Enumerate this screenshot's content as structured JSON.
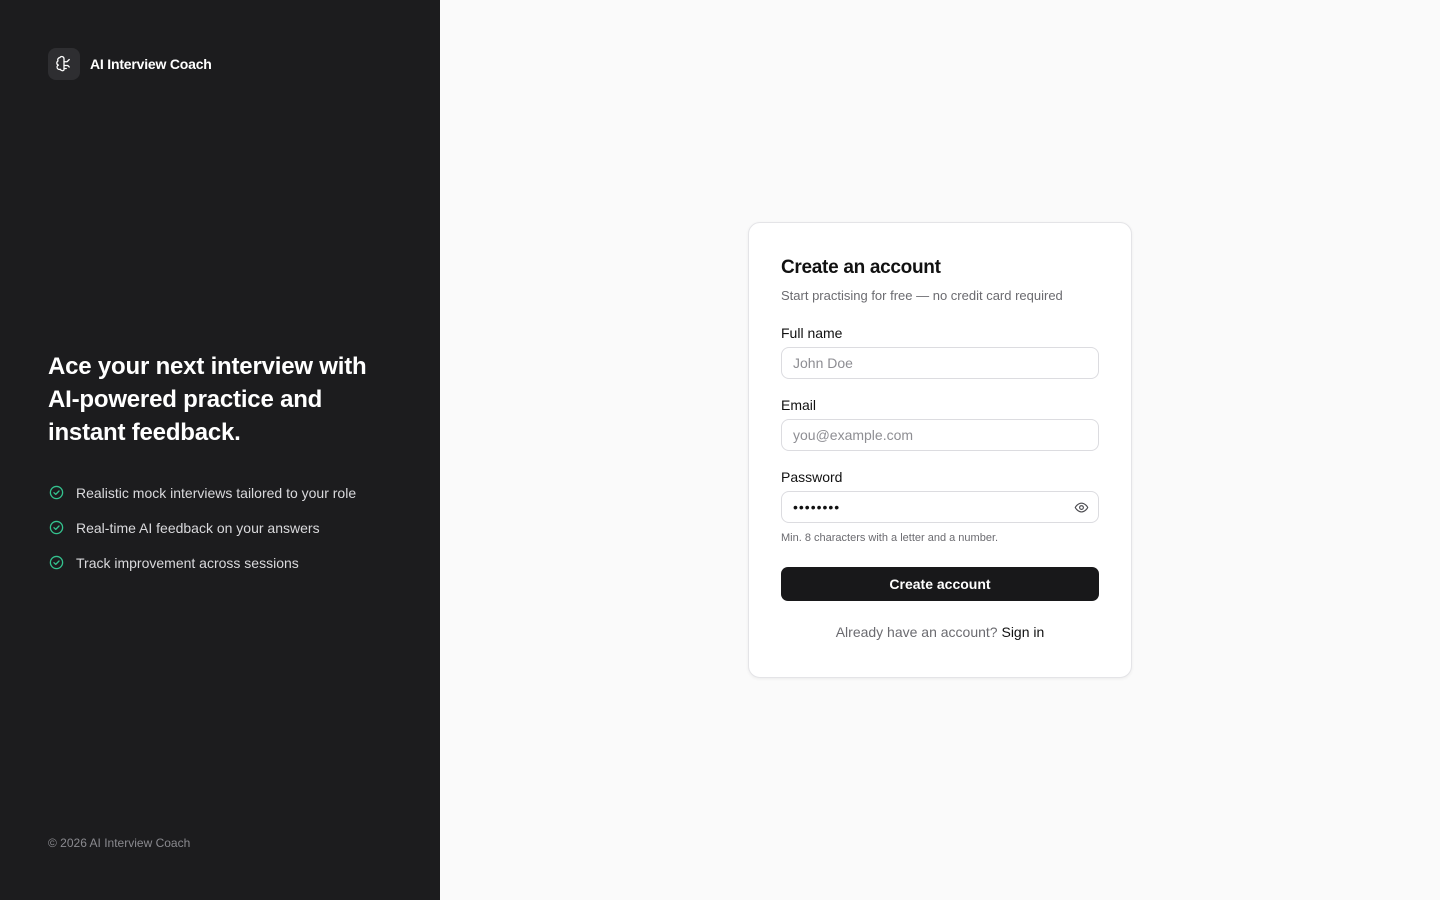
{
  "brand": {
    "name": "AI Interview Coach",
    "logo_icon": "brain-icon"
  },
  "hero": {
    "headline": "Ace your next interview with AI-powered practice and instant feedback.",
    "features": [
      "Realistic mock interviews tailored to your role",
      "Real-time AI feedback on your answers",
      "Track improvement across sessions"
    ],
    "feature_icon": "check-circle-icon"
  },
  "footer": {
    "copyright": "© 2026 AI Interview Coach"
  },
  "form": {
    "title": "Create an account",
    "subtitle": "Start practising for free — no credit card required",
    "full_name": {
      "label": "Full name",
      "placeholder": "John Doe",
      "value": ""
    },
    "email": {
      "label": "Email",
      "placeholder": "you@example.com",
      "value": ""
    },
    "password": {
      "label": "Password",
      "value": "••••••••",
      "hint": "Min. 8 characters with a letter and a number.",
      "toggle_icon": "eye-icon"
    },
    "submit_label": "Create account",
    "signin_prompt": "Already have an account?",
    "signin_link": "Sign in"
  },
  "colors": {
    "sidebar_bg": "#1c1c1e",
    "page_bg": "#fafafa",
    "accent_green": "#34c38f",
    "button_bg": "#18181a"
  }
}
